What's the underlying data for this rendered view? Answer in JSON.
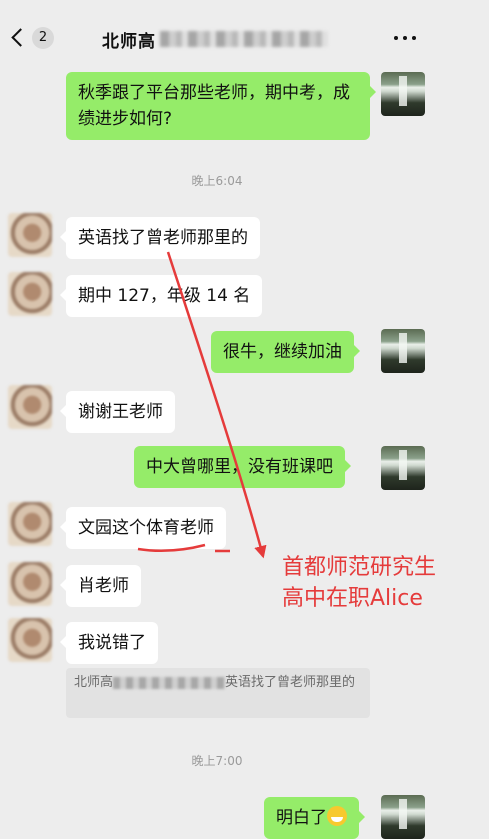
{
  "header": {
    "back_count": "2",
    "title": "北师高",
    "more_icon": "more-dots-icon"
  },
  "messages": [
    {
      "side": "out",
      "text": "秋季跟了平台那些老师，期中考，成绩进步如何?"
    },
    {
      "type": "time",
      "text": "晚上6:04"
    },
    {
      "side": "in",
      "text": "英语找了曾老师那里的"
    },
    {
      "side": "in",
      "text": "期中 127，年级 14 名"
    },
    {
      "side": "out",
      "text": "很牛，继续加油"
    },
    {
      "side": "in",
      "text": "谢谢王老师"
    },
    {
      "side": "out",
      "text": "中大曾哪里，没有班课吧"
    },
    {
      "side": "in",
      "text": "文园这个体育老师"
    },
    {
      "side": "in",
      "text": "肖老师"
    },
    {
      "side": "in",
      "text": "我说错了"
    },
    {
      "type": "quote",
      "prefix": "北师高",
      "suffix": "英语找了曾老师那里的"
    },
    {
      "type": "time",
      "text": "晚上7:00"
    },
    {
      "side": "out",
      "text": "明白了",
      "emoji": "grinning-face-emoji"
    }
  ],
  "annotation": {
    "line1": "首都师范研究生",
    "line2": "高中在职Alice",
    "color": "#e53b3b"
  },
  "colors": {
    "outgoing_bubble": "#95ec69",
    "incoming_bubble": "#ffffff",
    "background": "#ededed"
  }
}
